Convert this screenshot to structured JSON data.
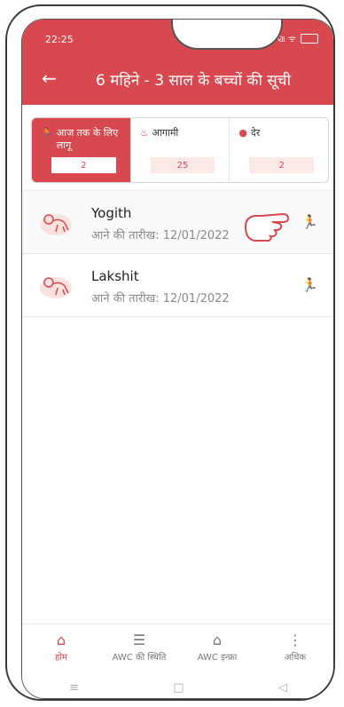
{
  "status": {
    "time": "22:25",
    "icons_text": "ଏ ସା ᯤ"
  },
  "header": {
    "back_glyph": "←",
    "title": "6 महिने - 3 साल के बच्चों की सूची"
  },
  "summary": [
    {
      "label": "आज तक के लिए लागू",
      "count": "2",
      "icon": "runner-icon"
    },
    {
      "label": "आगामी",
      "count": "25",
      "icon": "cake-icon"
    },
    {
      "label": "देर",
      "count": "2",
      "icon": "alert-icon"
    }
  ],
  "children": [
    {
      "name": "Yogith",
      "date": "आने की तारीख: 12/01/2022"
    },
    {
      "name": "Lakshit",
      "date": "आने की तारीख: 12/01/2022"
    }
  ],
  "nav": [
    {
      "label": "होम",
      "icon": "home-icon",
      "active": true
    },
    {
      "label": "AWC की स्थिति",
      "icon": "list-icon",
      "active": false
    },
    {
      "label": "AWC इन्फ्रा",
      "icon": "building-icon",
      "active": false
    },
    {
      "label": "अधिक",
      "icon": "more-icon",
      "active": false
    }
  ],
  "colors": {
    "accent": "#d8484f",
    "count_bg": "#fbe9e8"
  }
}
